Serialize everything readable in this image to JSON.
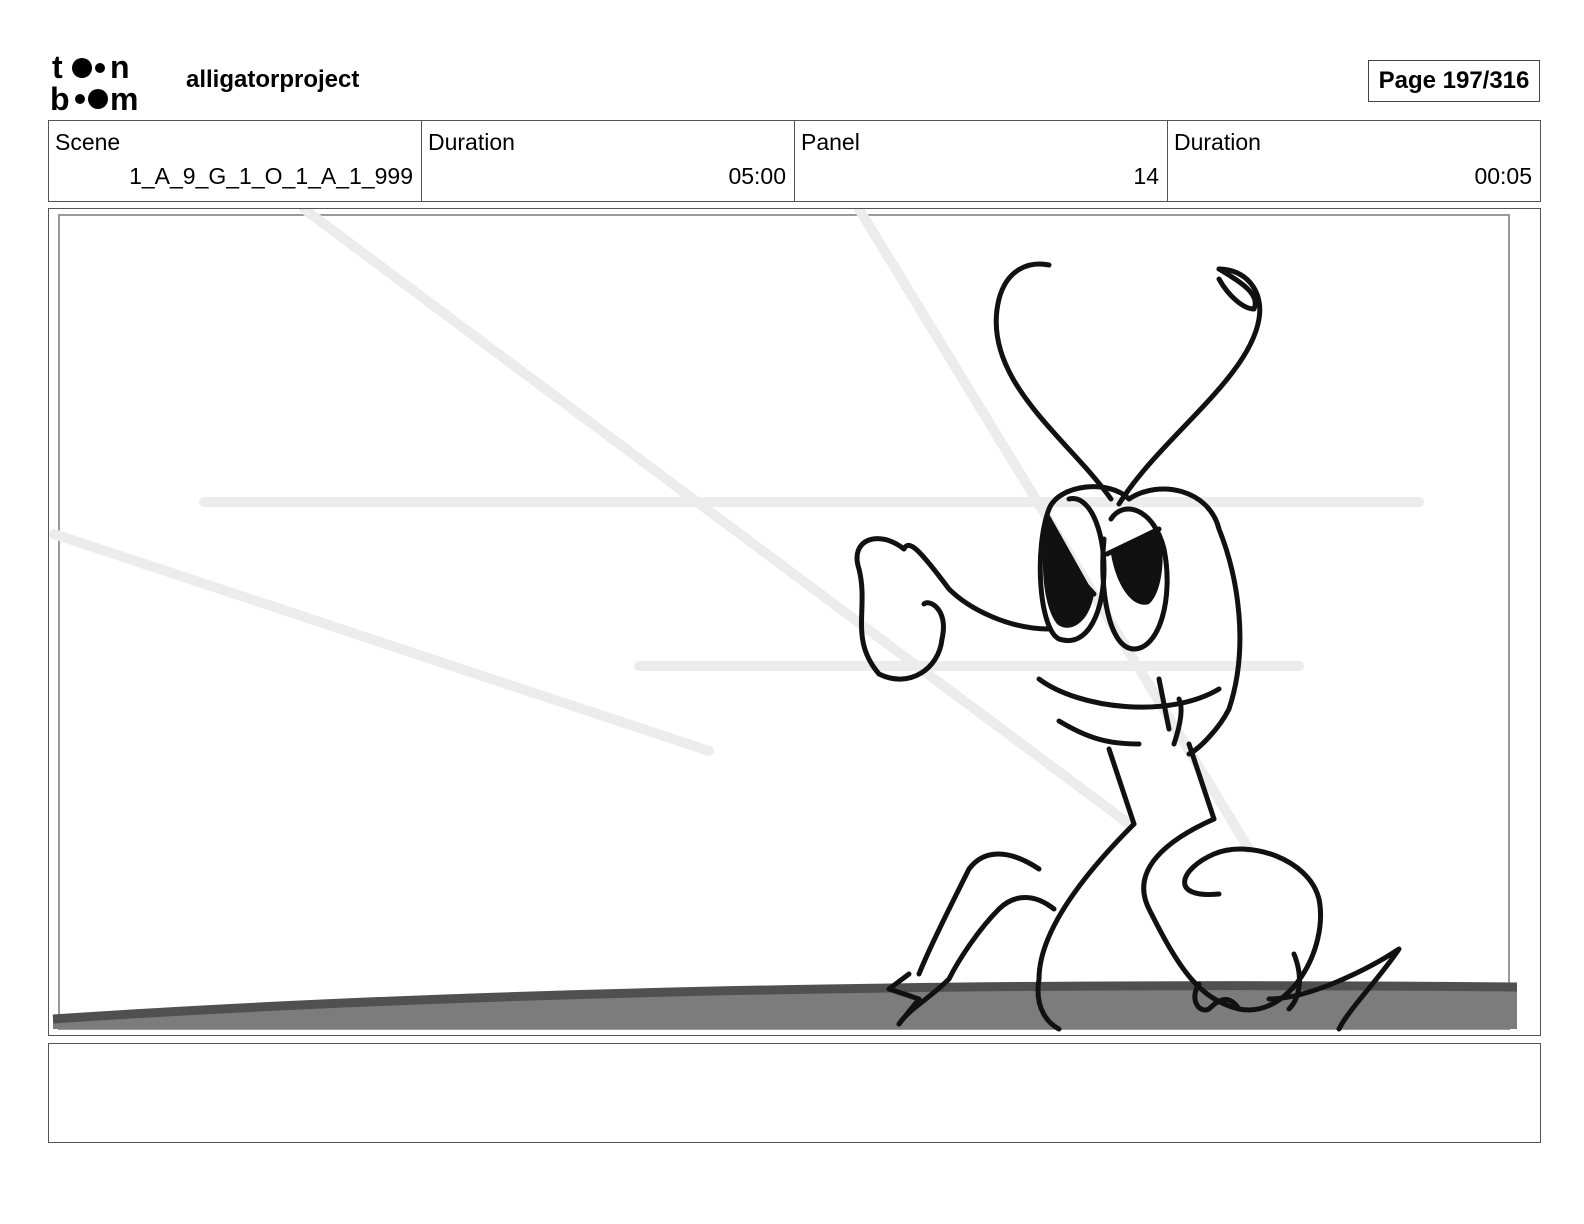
{
  "header": {
    "logo_text": "toonboom",
    "project": "alligatorproject",
    "page": "Page 197/316"
  },
  "info": {
    "scene_label": "Scene",
    "scene_value": "1_A_9_G_1_O_1_A_1_999",
    "duration_label": "Duration",
    "duration_value": "05:00",
    "panel_label": "Panel",
    "panel_value": "14",
    "panel_duration_label": "Duration",
    "panel_duration_value": "00:05"
  },
  "notes": {
    "text": ""
  }
}
